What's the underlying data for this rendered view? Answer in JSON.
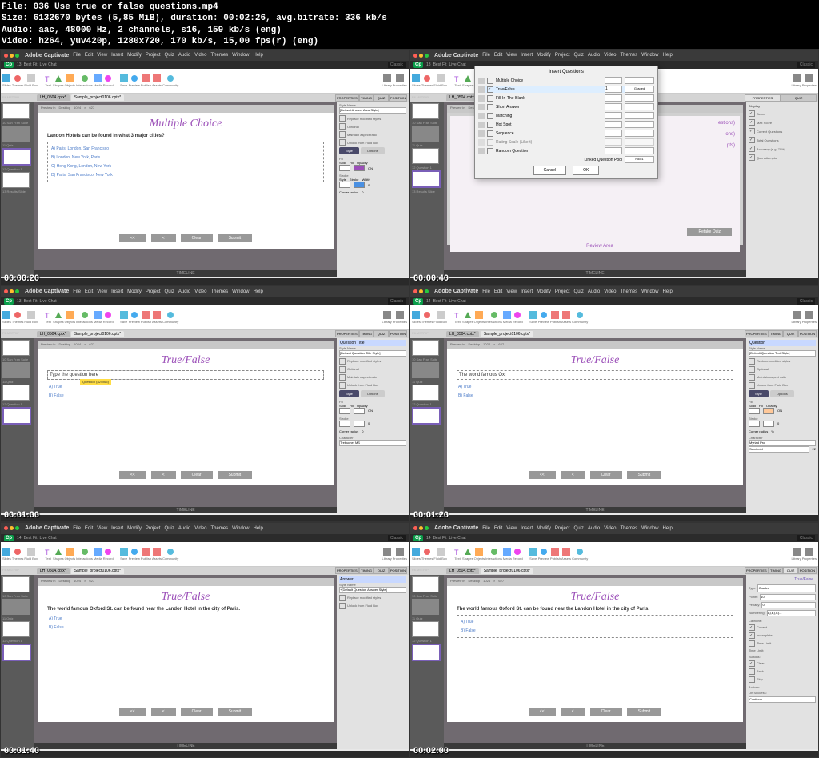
{
  "header": {
    "file": "File: 036 Use true or false questions.mp4",
    "size": "Size: 6132670 bytes (5,85 MiB), duration: 00:02:26, avg.bitrate: 336 kb/s",
    "audio": "Audio: aac, 48000 Hz, 2 channels, s16, 159 kb/s (eng)",
    "video": "Video: h264, yuv420p, 1280x720, 170 kb/s, 15,00 fps(r) (eng)"
  },
  "timestamps": [
    "00:00:20",
    "00:00:40",
    "00:01:00",
    "00:01:20",
    "00:01:40",
    "00:02:00"
  ],
  "app_title": "Adobe Captivate",
  "menus": [
    "File",
    "Edit",
    "View",
    "Insert",
    "Modify",
    "Project",
    "Quiz",
    "Audio",
    "Video",
    "Themes",
    "Window",
    "Help"
  ],
  "classic": "Classic",
  "ribbon": [
    "Slides",
    "Themes",
    "Fluid Box",
    "Text",
    "Shapes",
    "Objects",
    "Interactions",
    "Media",
    "Record",
    "Save",
    "Preview",
    "Publish",
    "Assets",
    "Community",
    "Library",
    "Properties"
  ],
  "tabs": {
    "a": "LH_0504.cptx*",
    "b": "Sample_project0106.cptx*"
  },
  "preview": {
    "label": "Preview in",
    "desktop": "Desktop",
    "w": "1024",
    "h": "627"
  },
  "appbar": {
    "zoom": "13",
    "mid": [
      "Best Fit",
      "Live Chat"
    ]
  },
  "filmstrip": {
    "label": "FILMSTRIP",
    "slides": [
      "10 San Fran Suite",
      "11 Quiz",
      "12 Question 1",
      "13 Results Slide"
    ]
  },
  "props_tabs": [
    "PROPERTIES",
    "TIMING",
    "QUIZ",
    "POSITION"
  ],
  "timeline_label": "TIMELINE",
  "frame1": {
    "title": "Multiple Choice",
    "question": "Landon Hotels can be found in what 3 major cities?",
    "answers": [
      "A)  Paris, London, San Francisco",
      "B)  London, New York, Paris",
      "C)  Hong Kong, London, New York",
      "D)  Paris, San Francisco, New York"
    ],
    "buttons": [
      "<<",
      "<",
      "Clear",
      "Submit"
    ],
    "style_name": "Style Name",
    "style_val": "[Default Answer Area Style]",
    "checks": [
      "Replace modified styles",
      "Optional",
      "Maintain aspect ratio",
      "Unlock from Fluid Box"
    ],
    "style": "Style",
    "options": "Options",
    "fill": "Fill",
    "solid": "Solid",
    "opacity": "Opacity",
    "on": "ON",
    "stroke": "Stroke",
    "sstyle": "Style",
    "sfill": "Stroke",
    "width": "Width",
    "w": "0",
    "corner": "Corner radius",
    "cr": "0"
  },
  "frame2": {
    "dialog_title": "Insert Questions",
    "types": [
      "Multiple Choice",
      "True/False",
      "Fill-In-The-Blank",
      "Short Answer",
      "Matching",
      "Hot Spot",
      "Sequence",
      "Rating Scale (Likert)",
      "Random Question"
    ],
    "graded": "Graded",
    "count": "1",
    "link": "Linked Question Pool",
    "pool": "Pool1",
    "cancel": "Cancel",
    "ok": "OK",
    "review_title": "Review Area",
    "review_texts": [
      "estions)",
      "ons)",
      "pts)"
    ],
    "retake": "Retake Quiz",
    "props_title": "QUIZ",
    "display": "Display",
    "checks": [
      "Score",
      "Max Score",
      "Correct Questions",
      "Total Questions",
      "Accuracy (e.g. 70%)",
      "Quiz Attempts"
    ]
  },
  "frame3": {
    "title": "True/False",
    "prompt": "Type the question here",
    "tag": "Question (824x65)",
    "answers": [
      "A)  True",
      "B)  False"
    ],
    "buttons": [
      "<<",
      "<",
      "Clear",
      "Submit"
    ],
    "header_tag": "Question Title",
    "style_name": "Style Name",
    "style_val": "[Default Question Title Style]",
    "checks": [
      "Replace modified styles",
      "Optional",
      "Maintain aspect ratio",
      "Unlock from Fluid Box"
    ],
    "style": "Style",
    "options": "Options",
    "fill": "Fill",
    "solid": "Solid",
    "opacity": "Opacity",
    "on": "ON",
    "stroke": "Stroke",
    "width": "Width",
    "w": "0",
    "corner": "Corner radius",
    "cr": "0",
    "character": "Character",
    "font": "Trebuchet MS"
  },
  "frame4": {
    "title": "True/False",
    "question": "The world famous Ox|",
    "answers": [
      "A)  True",
      "B)  False"
    ],
    "buttons": [
      "<<",
      "<",
      "Clear",
      "Submit"
    ],
    "header_tag": "Question",
    "style_name": "Style Name",
    "style_val": "[Default Question Text Style]",
    "checks": [
      "Replace modified styles",
      "Optional",
      "Maintain aspect ratio",
      "Unlock from Fluid Box"
    ],
    "style": "Style",
    "options": "Options",
    "fill": "Fill",
    "solid": "Solid",
    "opacity": "Opacity",
    "on": "ON",
    "stroke": "Stroke",
    "width": "Width",
    "w": "0",
    "corner": "Corner radius",
    "cr": "%",
    "character": "Character",
    "font": "Myriad Pro",
    "size": "22",
    "semibold": "Semibold"
  },
  "frame5": {
    "title": "True/False",
    "question": "The world famous Oxford St. can be found near the Landon Hotel in the city of Paris.",
    "answers": [
      "A)  True",
      "B)  False"
    ],
    "buttons": [
      "<<",
      "<",
      "Clear",
      "Submit"
    ],
    "header_tag": "Answer",
    "style_name": "Style Name",
    "style_val": "+[Default Question Answer Style]",
    "checks": [
      "Replace modified styles",
      "Unlock from Fluid Box"
    ]
  },
  "frame6": {
    "title": "True/False",
    "question": "The world famous Oxford St. can be found near the Landon Hotel in the city of Paris.",
    "answers": [
      "A)  True",
      "B)  False"
    ],
    "buttons": [
      "<<",
      "<",
      "Clear",
      "Submit"
    ],
    "tf": "True/False",
    "type": "Type",
    "graded": "Graded",
    "points": "Points:",
    "points_val": "10",
    "penalty": "Penalty:",
    "penalty_val": "0",
    "numbering": "Numbering:",
    "numbering_val": "A),B),C)...",
    "captions": "Captions:",
    "cap_items": [
      "Correct",
      "Incomplete",
      "Time Limit"
    ],
    "timelimit": "Time Limit:",
    "buttons_label": "Buttons:",
    "btn_items": [
      "Clear",
      "Back",
      "Skip"
    ],
    "actions": "Actions:",
    "on_success": "On Success:",
    "continue": "Continue"
  }
}
